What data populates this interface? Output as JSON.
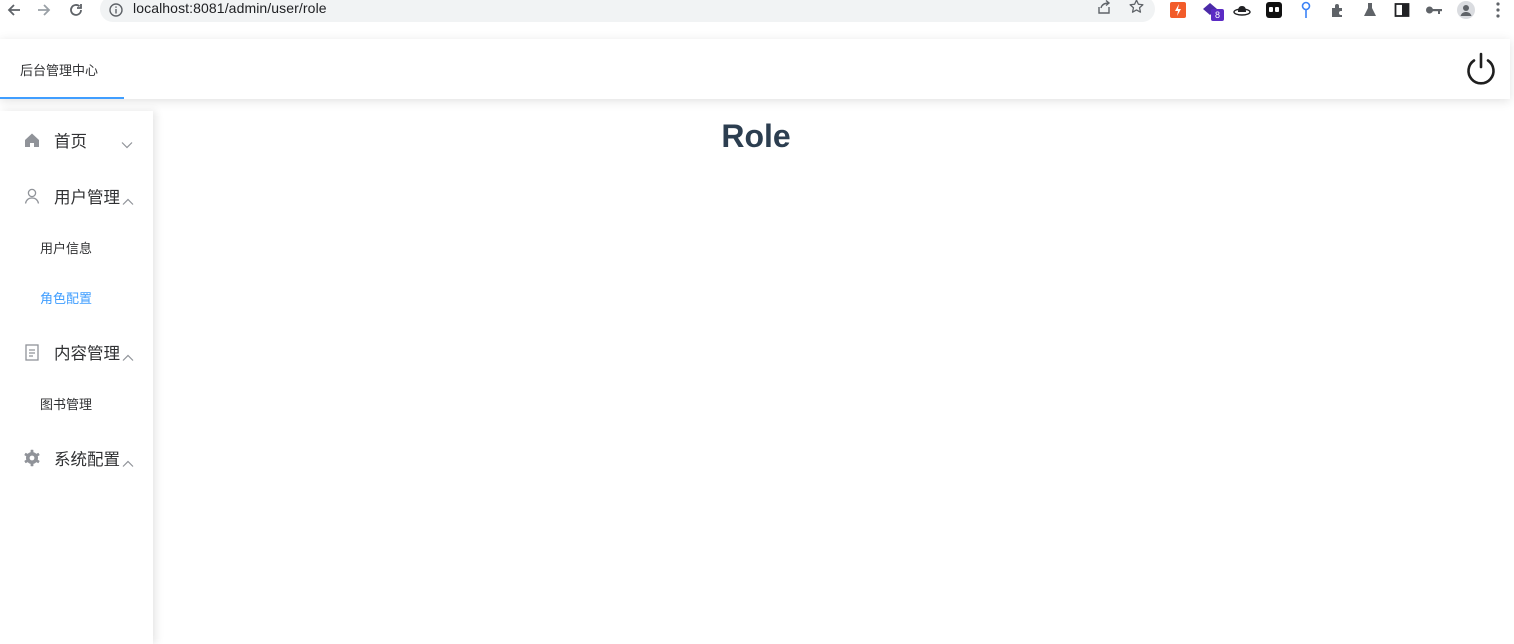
{
  "browser": {
    "url": "localhost:8081/admin/user/role",
    "extension_badge": "8",
    "icons": [
      "back-icon",
      "forward-icon",
      "reload-icon",
      "info-icon",
      "share-icon",
      "star-icon",
      "extensions-icon",
      "profile-icon",
      "menu-icon"
    ]
  },
  "header": {
    "title": "后台管理中心",
    "power_icon": "power-icon"
  },
  "sidebar": {
    "items": [
      {
        "label": "首页",
        "icon": "home-icon",
        "expanded": false
      },
      {
        "label": "用户管理",
        "icon": "user-icon",
        "expanded": true,
        "children": [
          {
            "label": "用户信息",
            "active": false
          },
          {
            "label": "角色配置",
            "active": true
          }
        ]
      },
      {
        "label": "内容管理",
        "icon": "document-icon",
        "expanded": true,
        "children": [
          {
            "label": "图书管理",
            "active": false
          }
        ]
      },
      {
        "label": "系统配置",
        "icon": "gear-icon",
        "expanded": true
      }
    ]
  },
  "main": {
    "title": "Role"
  },
  "colors": {
    "accent": "#409eff",
    "title": "#2c3e50",
    "text": "#303133",
    "icon": "#909399"
  }
}
